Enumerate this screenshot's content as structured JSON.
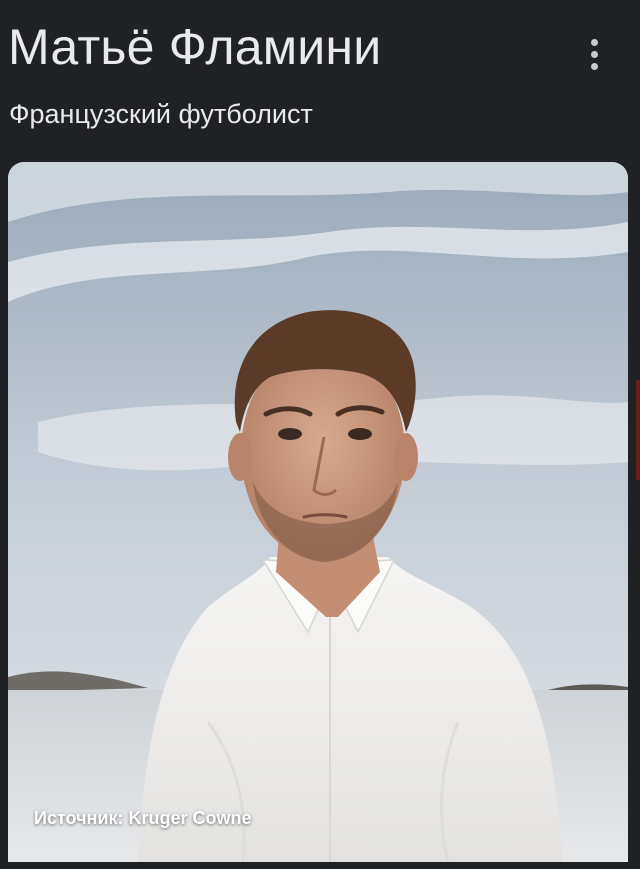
{
  "entity": {
    "title": "Матьё Фламини",
    "subtitle": "Французский футболист"
  },
  "menu": {
    "icon": "more-vert-icon"
  },
  "image": {
    "source_caption": "Источник: Kruger Cowne"
  },
  "colors": {
    "background": "#202124",
    "text_primary": "#e8eaed",
    "sky": "#aebccb",
    "shirt": "#f1f0ee",
    "sea": "#d6d9dc"
  }
}
